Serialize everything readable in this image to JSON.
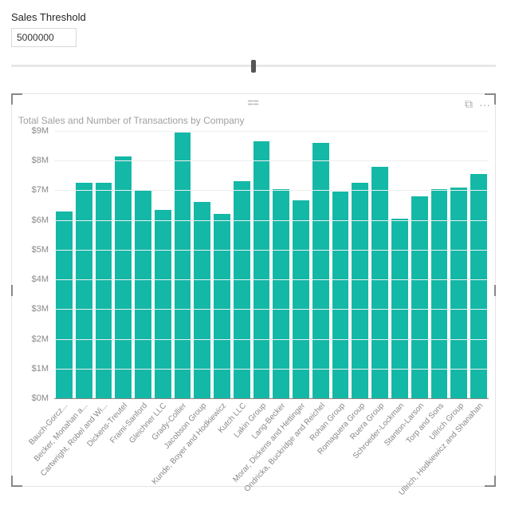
{
  "threshold": {
    "label": "Sales Threshold",
    "value": "5000000"
  },
  "visual": {
    "title": "Total Sales and Number of Transactions by Company",
    "focus_icon": "⧉",
    "more_icon": "···"
  },
  "chart_data": {
    "type": "bar",
    "title": "Total Sales and Number of Transactions by Company",
    "xlabel": "",
    "ylabel": "",
    "ylim": [
      0,
      9000000
    ],
    "y_ticks": [
      "$0M",
      "$1M",
      "$2M",
      "$3M",
      "$4M",
      "$5M",
      "$6M",
      "$7M",
      "$8M",
      "$9M"
    ],
    "categories": [
      "Bauch-Gorcz...",
      "Becker, Monahan a...",
      "Cartwright, Robel and Wi...",
      "Dickens-Treutel",
      "Frami-Sanford",
      "Gleichner LLC",
      "Grady-Collier",
      "Jacobson Group",
      "Kunde, Boyer and Hodkiewicz",
      "Kutch LLC",
      "Lakin Group",
      "Lang-Becker",
      "Morar, Dickens and Hettinger",
      "Ondricka, Buckridge and Reichel",
      "Rohan Group",
      "Romaguera Group",
      "Ruera Group",
      "Schroeder-Lockman",
      "Stanton-Larson",
      "Torp and Sons",
      "Ullrich Group",
      "Ullrich, Hodkiewicz and Shanahan"
    ],
    "values": [
      6300000,
      7250000,
      7250000,
      8150000,
      7000000,
      6350000,
      8950000,
      6600000,
      6200000,
      7300000,
      8650000,
      7050000,
      6650000,
      8600000,
      6950000,
      7250000,
      7800000,
      6050000,
      6800000,
      7050000,
      7100000,
      7550000
    ]
  }
}
